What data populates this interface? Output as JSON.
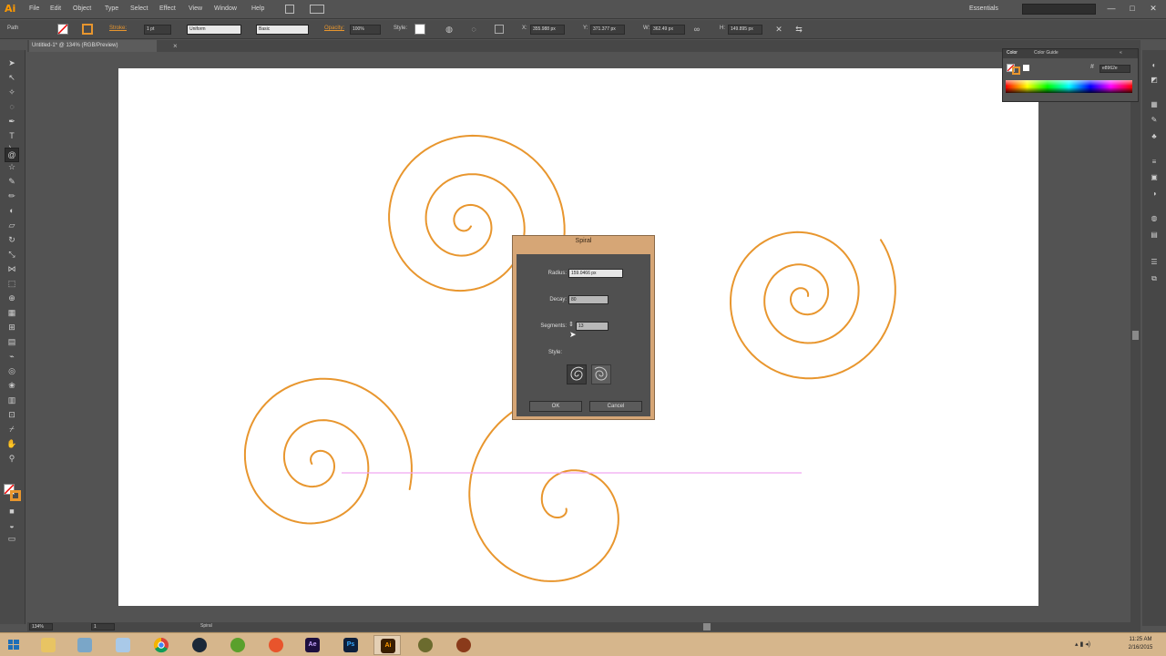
{
  "app": {
    "logo": "Ai"
  },
  "menus": [
    "File",
    "Edit",
    "Object",
    "Type",
    "Select",
    "Effect",
    "View",
    "Window",
    "Help"
  ],
  "workspace": "Essentials",
  "window_controls": {
    "minimize": "—",
    "maximize": "□",
    "close": "✕"
  },
  "controlbar": {
    "selection_label": "Path",
    "stroke_label": "Stroke:",
    "stroke_value": "1 pt",
    "profile_value": "Uniform",
    "brush_value": "Basic",
    "opacity_label": "Opacity:",
    "opacity_value": "100%",
    "style_label": "Style:",
    "x_value": "355.988 px",
    "y_value": "371.377 px",
    "w_value": "362.49 px",
    "h_value": "149.895 px",
    "stroke_color": "#e8962e"
  },
  "document": {
    "tab_title": "Untitled-1* @ 134% (RGB/Preview)",
    "close": "×"
  },
  "tool_icons": [
    "selection-icon",
    "direct-selection-icon",
    "magic-wand-icon",
    "lasso-icon",
    "pen-icon",
    "type-icon",
    "line-icon",
    "spiral-icon",
    "rectangle-icon",
    "paintbrush-icon",
    "pencil-icon",
    "blob-brush-icon",
    "eraser-icon",
    "rotate-icon",
    "scale-icon",
    "width-icon",
    "free-transform-icon",
    "shape-builder-icon",
    "perspective-icon",
    "mesh-icon",
    "gradient-icon",
    "eyedropper-icon",
    "blend-icon",
    "symbol-sprayer-icon",
    "column-graph-icon",
    "artboard-icon",
    "slice-icon",
    "hand-icon",
    "zoom-icon"
  ],
  "color_panel": {
    "tabs": [
      "Color",
      "Color Guide"
    ],
    "hex_value": "e8962e"
  },
  "dialog": {
    "title": "Spiral",
    "radius_label": "Radius:",
    "radius_value": "159.0466 px",
    "decay_label": "Decay:",
    "decay_value": "80",
    "segments_label": "Segments:",
    "segments_value": "13",
    "style_label": "Style:",
    "ok_label": "OK",
    "cancel_label": "Cancel"
  },
  "statusbar": {
    "zoom": "134%",
    "page": "1",
    "tool": "Spiral"
  },
  "taskbar": {
    "apps": [
      "windows-start-icon",
      "file-explorer-icon",
      "recycle-icon",
      "notepad-icon",
      "chrome-icon",
      "steam-icon",
      "game-controller-icon",
      "app-orange-icon",
      "after-effects-icon",
      "photoshop-icon",
      "illustrator-icon",
      "app-eye-icon",
      "app-bird-icon"
    ],
    "ae_label": "Ae",
    "ps_label": "Ps",
    "ai_label": "Ai",
    "time": "11:25 AM",
    "date": "2/16/2015"
  }
}
